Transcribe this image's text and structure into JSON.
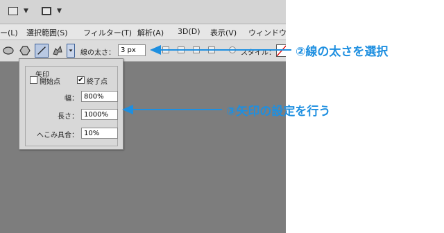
{
  "menu": {
    "items": [
      "ー(L)",
      "選択範囲(S)",
      "フィルター(T)",
      "解析(A)",
      "3D(D)",
      "表示(V)",
      "ウィンドウ(W)"
    ]
  },
  "options": {
    "stroke_label": "線の太さ：",
    "stroke_value": "3 px",
    "style_label": "スタイル："
  },
  "arrow_panel": {
    "title": "矢印",
    "start_label": "開始点",
    "start_checked": false,
    "end_label": "終了点",
    "end_checked": true,
    "check_mark": "✔",
    "width_label": "幅：",
    "width_value": "800%",
    "length_label": "長さ：",
    "length_value": "1000%",
    "concavity_label": "へこみ具合：",
    "concavity_value": "10%"
  },
  "annotations": {
    "stroke_note": "②線の太さを選択",
    "arrow_note": "③矢印の設定を行う",
    "color": "#1e8fe0"
  }
}
